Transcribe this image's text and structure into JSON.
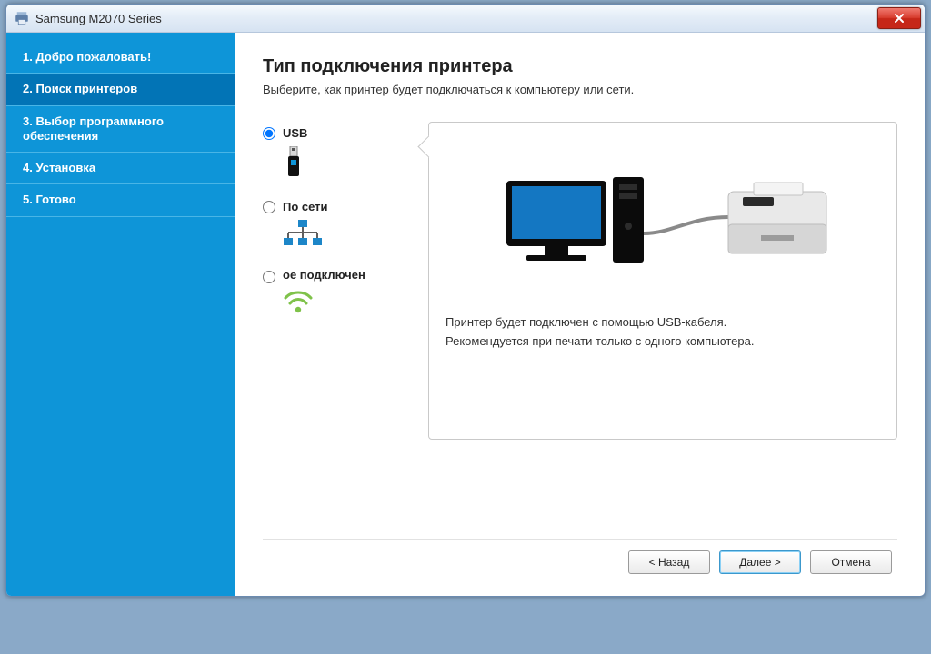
{
  "window": {
    "title": "Samsung M2070 Series"
  },
  "sidebar": {
    "steps": [
      {
        "label": "1. Добро пожаловать!",
        "active": false
      },
      {
        "label": "2. Поиск принтеров",
        "active": true
      },
      {
        "label": "3. Выбор программного обеспечения",
        "active": false
      },
      {
        "label": "4. Установка",
        "active": false
      },
      {
        "label": "5. Готово",
        "active": false
      }
    ]
  },
  "page": {
    "title": "Тип подключения принтера",
    "subtitle": "Выберите, как принтер будет подключаться к компьютеру или сети."
  },
  "options": {
    "usb": {
      "label": "USB",
      "selected": true
    },
    "network": {
      "label": "По сети",
      "selected": false
    },
    "wireless": {
      "label": "ое подключен",
      "selected": false
    }
  },
  "info": {
    "line1": "Принтер будет подключен с помощью USB-кабеля.",
    "line2": "Рекомендуется при печати только с одного компьютера."
  },
  "buttons": {
    "back": "< Назад",
    "next": "Далее >",
    "cancel": "Отмена"
  },
  "colors": {
    "sidebar": "#0e95d8",
    "sidebar_active": "#0274b6",
    "close": "#d73d2e"
  }
}
